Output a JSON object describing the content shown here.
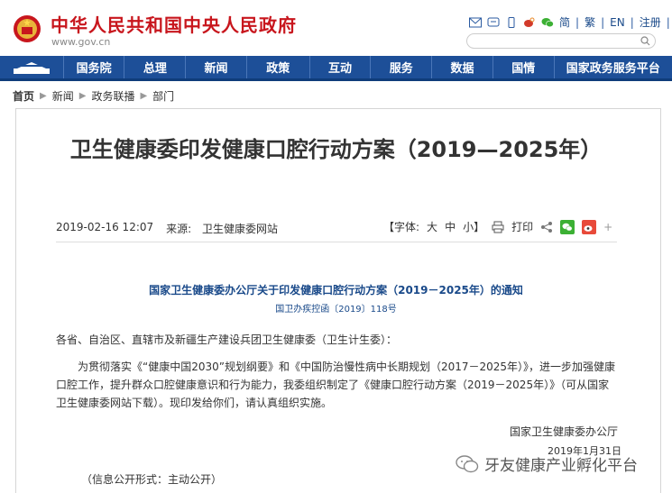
{
  "header": {
    "site_title": "中华人民共和国中央人民政府",
    "site_url": "www.gov.cn",
    "lang_simplified": "简",
    "lang_traditional": "繁",
    "lang_en": "EN",
    "register": "注册"
  },
  "nav": {
    "items": [
      "国务院",
      "总理",
      "新闻",
      "政策",
      "互动",
      "服务",
      "数据",
      "国情",
      "国家政务服务平台"
    ]
  },
  "breadcrumb": [
    "首页",
    "新闻",
    "政务联播",
    "部门"
  ],
  "article": {
    "title": "卫生健康委印发健康口腔行动方案（2019—2025年）",
    "date": "2019-02-16 12:07",
    "source_label": "来源:",
    "source": "卫生健康委网站",
    "font_label": "【字体:",
    "font_big": "大",
    "font_mid": "中",
    "font_small": "小】",
    "print": "打印",
    "notice_title": "国家卫生健康委办公厅关于印发健康口腔行动方案（2019－2025年）的通知",
    "doc_no": "国卫办疾控函〔2019〕118号",
    "salutation": "各省、自治区、直辖市及新疆生产建设兵团卫生健康委（卫生计生委）：",
    "paragraph": "为贯彻落实《“健康中国2030”规划纲要》和《中国防治慢性病中长期规划（2017－2025年）》，进一步加强健康口腔工作，提升群众口腔健康意识和行为能力，我委组织制定了《健康口腔行动方案（2019－2025年）》（可从国家卫生健康委网站下载）。现印发给你们，请认真组织实施。",
    "signature": "国家卫生健康委办公厅",
    "sign_date": "2019年1月31日",
    "info_disclosure": "（信息公开形式：主动公开）"
  },
  "watermark": {
    "text": "牙友健康产业孵化平台"
  },
  "colors": {
    "brand_red": "#c8161d",
    "nav_blue": "#1d4f98",
    "link_blue": "#1a4a8a"
  }
}
